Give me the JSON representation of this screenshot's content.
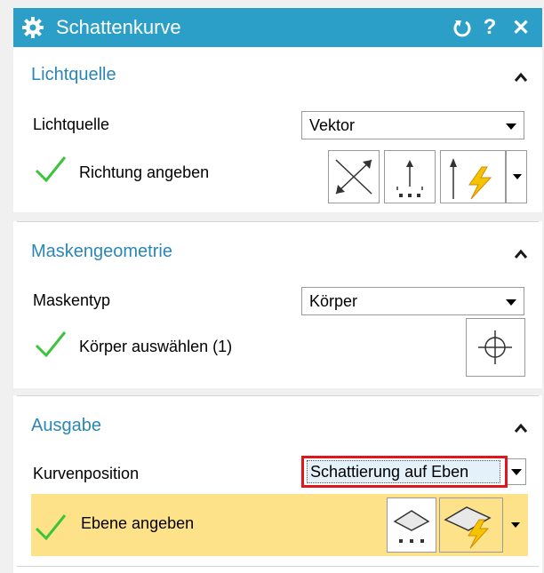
{
  "dialog": {
    "title": "Schattenkurve",
    "icons": {
      "settings": "gear-icon",
      "reset": "reset-icon",
      "help": "help-icon",
      "close": "close-icon"
    },
    "help_label": "?",
    "close_label": "✕"
  },
  "sections": {
    "light": {
      "heading": "Lichtquelle",
      "field_label": "Lichtquelle",
      "field_value": "Vektor",
      "status_label": "Richtung angeben"
    },
    "mask": {
      "heading": "Maskengeometrie",
      "field_label": "Maskentyp",
      "field_value": "Körper",
      "status_label": "Körper auswählen (1)"
    },
    "output": {
      "heading": "Ausgabe",
      "field_label": "Kurvenposition",
      "field_value": "Schattierung auf Eben",
      "status_label": "Ebene angeben"
    }
  },
  "colors": {
    "title_bar": "#2b9fc7",
    "heading": "#2a87b5",
    "check": "#3ac43a",
    "highlight_row": "#fde28a",
    "focus_border": "#e0161c"
  }
}
